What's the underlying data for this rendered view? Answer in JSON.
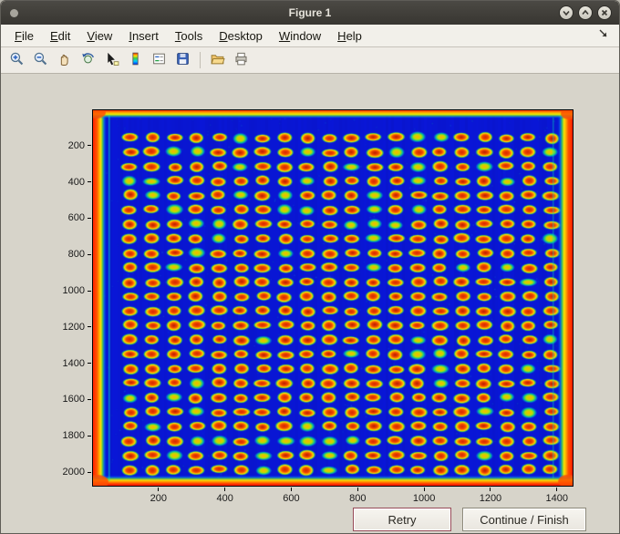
{
  "window": {
    "title": "Figure 1",
    "controls": {
      "shade": "shade-window",
      "maximize": "maximize-window",
      "close": "close-window"
    }
  },
  "menubar": {
    "items": [
      "File",
      "Edit",
      "View",
      "Insert",
      "Tools",
      "Desktop",
      "Window",
      "Help"
    ]
  },
  "toolbar": {
    "buttons": [
      "zoom-in",
      "zoom-out",
      "pan",
      "rotate-3d",
      "data-cursor",
      "insert-colorbar",
      "insert-legend",
      "save",
      "open",
      "print"
    ]
  },
  "actions": {
    "retry": "Retry",
    "continue": "Continue / Finish"
  },
  "colors": {
    "titlebar": "#403e39",
    "figure_background": "#d7d4ca",
    "plot_background": "#0a17d8",
    "edge_band": "#ff2a00",
    "spot_center": "#c41e00",
    "spot_ring": "#ffe000",
    "spot_halo": "#3cc850"
  },
  "chart_data": {
    "type": "heatmap",
    "title": "",
    "xlabel": "",
    "ylabel": "",
    "colormap": "jet",
    "x_range": [
      0,
      1450
    ],
    "y_range": [
      0,
      2080
    ],
    "y_axis_reversed": true,
    "x_ticks": [
      200,
      400,
      600,
      800,
      1000,
      1200,
      1400
    ],
    "y_ticks": [
      200,
      400,
      600,
      800,
      1000,
      1200,
      1400,
      1600,
      1800,
      2000
    ],
    "description": "Scanned plate image: regular grid of bright red/orange spots with yellow-green halos on a deep blue background; saturated red-orange saturation bands along all four edges of the image",
    "spot_grid": {
      "cols": 20,
      "rows": 24,
      "x_start": 112,
      "x_step": 67,
      "y_start": 152,
      "y_step": 80
    },
    "background_value_color": "#0a17d8",
    "edge_band_color": "#ff2a00"
  }
}
